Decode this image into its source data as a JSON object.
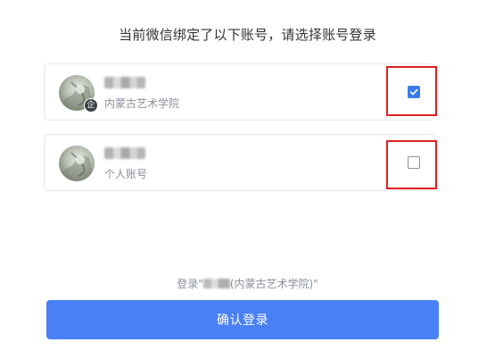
{
  "heading": "当前微信绑定了以下账号，请选择账号登录",
  "accounts": [
    {
      "name": "████",
      "subtitle": "内蒙古艺术学院",
      "badge": "企",
      "checked": true,
      "avatar_icon": "avatar-photo"
    },
    {
      "name": "████",
      "subtitle": "个人账号",
      "checked": false,
      "avatar_icon": "avatar-photo"
    }
  ],
  "login_hint": {
    "prefix": "登录\"",
    "name": "███",
    "suffix": "(内蒙古艺术学院)\""
  },
  "confirm_button": "确认登录",
  "colors": {
    "accent": "#4a80f5",
    "checkbox_checked": "#3b7bf0",
    "highlight": "#e02020"
  }
}
